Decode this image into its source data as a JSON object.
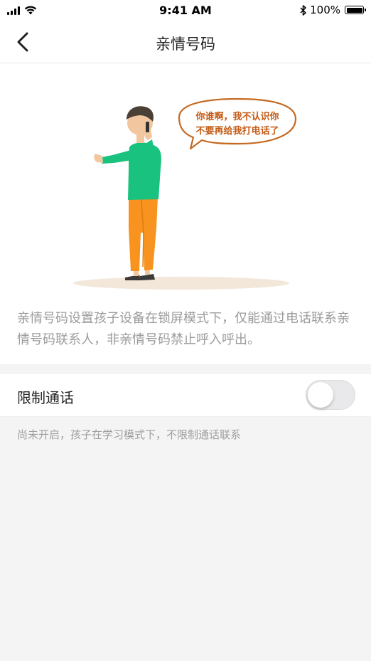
{
  "status_bar": {
    "time": "9:41 AM",
    "battery": "100%",
    "bluetooth_icon": "✱"
  },
  "nav": {
    "back_icon": "chevron-left-icon",
    "title": "亲情号码"
  },
  "illustration": {
    "speech_line1": "你谁啊，我不认识你",
    "speech_line2": "不要再给我打电话了",
    "colors": {
      "shirt": "#19c27e",
      "pants": "#f7931e",
      "skin": "#f2c7a0",
      "hair": "#4a4035",
      "bubble_border": "#c56a22",
      "bubble_text": "#c35a14",
      "ground": "#f3e7da"
    }
  },
  "intro": {
    "description": "亲情号码设置孩子设备在锁屏模式下，仅能通过电话联系亲情号码联系人，非亲情号码禁止呼入呼出。"
  },
  "restrict_call": {
    "label": "限制通话",
    "enabled": false
  },
  "hint": "尚未开启，孩子在学习模式下，不限制通话联系"
}
